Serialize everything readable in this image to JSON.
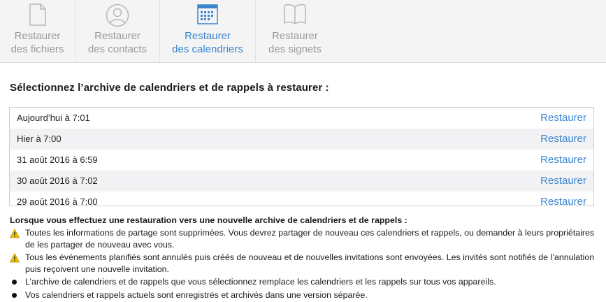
{
  "tabs": [
    {
      "label_line1": "Restaurer",
      "label_line2": "des fichiers",
      "icon": "file-icon",
      "active": false
    },
    {
      "label_line1": "Restaurer",
      "label_line2": "des contacts",
      "icon": "contact-icon",
      "active": false
    },
    {
      "label_line1": "Restaurer",
      "label_line2": "des calendriers",
      "icon": "calendar-icon",
      "active": true
    },
    {
      "label_line1": "Restaurer",
      "label_line2": "des signets",
      "icon": "book-icon",
      "active": false
    }
  ],
  "heading": "Sélectionnez l’archive de calendriers et de rappels à restaurer :",
  "archives": [
    {
      "date": "Aujourd’hui à 7:01",
      "action": "Restaurer"
    },
    {
      "date": "Hier à 7:00",
      "action": "Restaurer"
    },
    {
      "date": "31 août 2016 à 6:59",
      "action": "Restaurer"
    },
    {
      "date": "30 août 2016 à 7:02",
      "action": "Restaurer"
    },
    {
      "date": "29 août 2016 à 7:00",
      "action": "Restaurer"
    }
  ],
  "notes": {
    "title": "Lorsque vous effectuez une restauration vers une nouvelle archive de calendriers et de rappels :",
    "items": [
      {
        "type": "warning",
        "text": "Toutes les informations de partage sont supprimées. Vous devrez partager de nouveau ces calendriers et rappels, ou demander à leurs propriétaires de les partager de nouveau avec vous."
      },
      {
        "type": "warning",
        "text": "Tous les événements planifiés sont annulés puis créés de nouveau et de nouvelles invitations sont envoyées. Les invités sont notifiés de l’annulation puis reçoivent une nouvelle invitation."
      },
      {
        "type": "bullet",
        "text": "L’archive de calendriers et de rappels que vous sélectionnez remplace les calendriers et les rappels sur tous vos appareils."
      },
      {
        "type": "bullet",
        "text": "Vos calendriers et rappels actuels sont enregistrés et archivés dans une version séparée."
      }
    ]
  },
  "colors": {
    "accent": "#3b86cf",
    "inactive": "#9a9a9a",
    "warning": "#f2c200"
  }
}
